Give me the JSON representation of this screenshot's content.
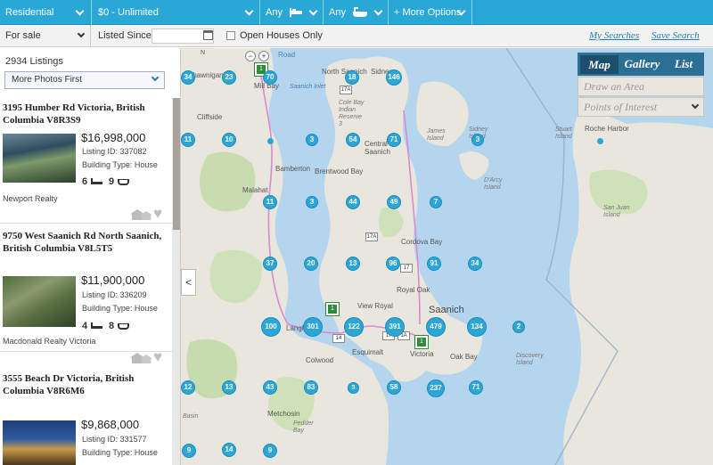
{
  "filters": {
    "property_type": "Residential",
    "price": "$0 - Unlimited",
    "beds": "Any",
    "baths": "Any",
    "more_options": "+ More Options"
  },
  "bar2": {
    "transaction": "For sale",
    "listed_since_label": "Listed Since",
    "open_houses_label": "Open Houses Only",
    "my_searches": "My Searches",
    "save_search": "Save Search"
  },
  "sidebar": {
    "count": "2934 Listings",
    "sort": "More Photos First"
  },
  "listings": [
    {
      "address": "3195 Humber Rd Victoria, British Columbia V8R3S9",
      "price": "$16,998,000",
      "listing_id": "Listing ID: 337082",
      "building_type": "Building Type: House",
      "beds": "6",
      "baths": "9",
      "brokerage": "Newport Realty"
    },
    {
      "address": "9750 West Saanich Rd North Saanich, British Columbia V8L5T5",
      "price": "$11,900,000",
      "listing_id": "Listing ID: 336209",
      "building_type": "Building Type: House",
      "beds": "4",
      "baths": "8",
      "brokerage": "Macdonald Realty Victoria"
    },
    {
      "address": "3555 Beach Dr Victoria, British Columbia V8R6M6",
      "price": "$9,868,000",
      "listing_id": "Listing ID: 331577",
      "building_type": "Building Type: House",
      "beds": "",
      "baths": "",
      "brokerage": ""
    }
  ],
  "map": {
    "collapse": "<",
    "road_label": "Road",
    "zoom_out": "−",
    "zoom_in": "+",
    "compass": "N",
    "views": {
      "map": "Map",
      "gallery": "Gallery",
      "list": "List"
    },
    "draw_area": "Draw an Area",
    "poi": "Points of Interest",
    "clusters": [
      "34",
      "23",
      "70",
      "18",
      "146",
      "10",
      "11",
      "3",
      "54",
      "71",
      "3",
      "11",
      "3",
      "44",
      "49",
      "7",
      "37",
      "20",
      "13",
      "96",
      "91",
      "34",
      "100",
      "301",
      "122",
      "391",
      "479",
      "134",
      "2",
      "12",
      "13",
      "43",
      "83",
      "3",
      "58",
      "237",
      "71",
      "9",
      "14",
      "9"
    ],
    "places": [
      "Shawnigan",
      "Mill Bay",
      "North Saanich",
      "Sidney",
      "Saanich Inlet",
      "Cole Bay Indian Reserve 3",
      "Cliffside",
      "Bamberton",
      "Brentwood Bay",
      "Central Saanich",
      "James Island",
      "Sidney Island",
      "Roche Harbor",
      "Malahat",
      "Cordova Bay",
      "D'Arcy Island",
      "Stuart Island",
      "San Juan Island",
      "Saanich",
      "View Royal",
      "Royal Oak",
      "Langford",
      "Colwood",
      "Esquimalt",
      "Victoria",
      "Oak Bay",
      "Discovery Island",
      "Metchosin",
      "Basin",
      "Pedder Bay"
    ],
    "shields": [
      "17A",
      "1",
      "17",
      "17A",
      "1A",
      "1",
      "17",
      "1",
      "14"
    ]
  }
}
